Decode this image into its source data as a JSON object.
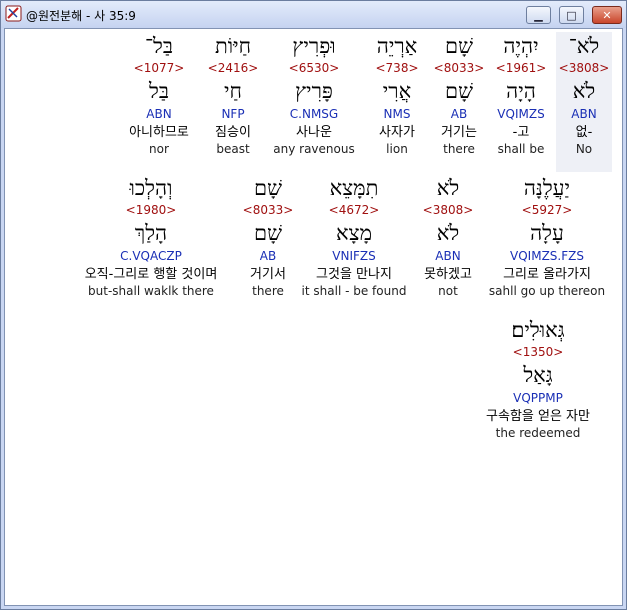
{
  "window": {
    "title": "@원전분해 - 사 35:9",
    "icon": "app-icon",
    "buttons": {
      "minimize": "minimize-icon",
      "maximize": "maximize-icon",
      "close": "close-icon"
    }
  },
  "words": [
    {
      "hebrew": "לֹא־",
      "strong": "<3808>",
      "lemma": "לֹא",
      "morph": "ABN",
      "korean": "없-",
      "english": "No"
    },
    {
      "hebrew": "יִהְיֶה",
      "strong": "<1961>",
      "lemma": "הָיָה",
      "morph": "VQIMZS",
      "korean": "-고",
      "english": "shall be"
    },
    {
      "hebrew": "שָׁם",
      "strong": "<8033>",
      "lemma": "שָׁם",
      "morph": "AB",
      "korean": "거기는",
      "english": "there"
    },
    {
      "hebrew": "אַרְיֵה",
      "strong": "<738>",
      "lemma": "אֲרִי",
      "morph": "NMS",
      "korean": "사자가",
      "english": "lion"
    },
    {
      "hebrew": "וּפְרִיץ",
      "strong": "<6530>",
      "lemma": "פָּרִיץ",
      "morph": "C.NMSG",
      "korean": "사나운",
      "english": "any ravenous"
    },
    {
      "hebrew": "חַיּוֹת",
      "strong": "<2416>",
      "lemma": "חַי",
      "morph": "NFP",
      "korean": "짐승이",
      "english": "beast"
    },
    {
      "hebrew": "בַּל־",
      "strong": "<1077>",
      "lemma": "בַּל",
      "morph": "ABN",
      "korean": "아니하므로",
      "english": "nor"
    },
    {
      "hebrew": "יַעֲלֶנָּה",
      "strong": "<5927>",
      "lemma": "עָלָה",
      "morph": "VQIMZS.FZS",
      "korean": "그리로 올라가지",
      "english": "sahll go up thereon"
    },
    {
      "hebrew": "לֹא",
      "strong": "<3808>",
      "lemma": "לֹא",
      "morph": "ABN",
      "korean": "못하겠고",
      "english": "not"
    },
    {
      "hebrew": "תִמָּצֵא",
      "strong": "<4672>",
      "lemma": "מָצָא",
      "morph": "VNIFZS",
      "korean": "그것을 만나지",
      "english": "it shall - be found"
    },
    {
      "hebrew": "שָׁם",
      "strong": "<8033>",
      "lemma": "שָׁם",
      "morph": "AB",
      "korean": "거기서",
      "english": "there"
    },
    {
      "hebrew": "וְהָלְכוּ",
      "strong": "<1980>",
      "lemma": "הָלַךְ",
      "morph": "C.VQACZP",
      "korean": "오직-그리로 행할 것이며",
      "english": "but-shall waklk there"
    },
    {
      "hebrew": "גְּאוּלִים׃",
      "strong": "<1350>",
      "lemma": "גָּאַל",
      "morph": "VQPPMP",
      "korean": "구속함을 얻은 자만",
      "english": "the redeemed"
    }
  ]
}
